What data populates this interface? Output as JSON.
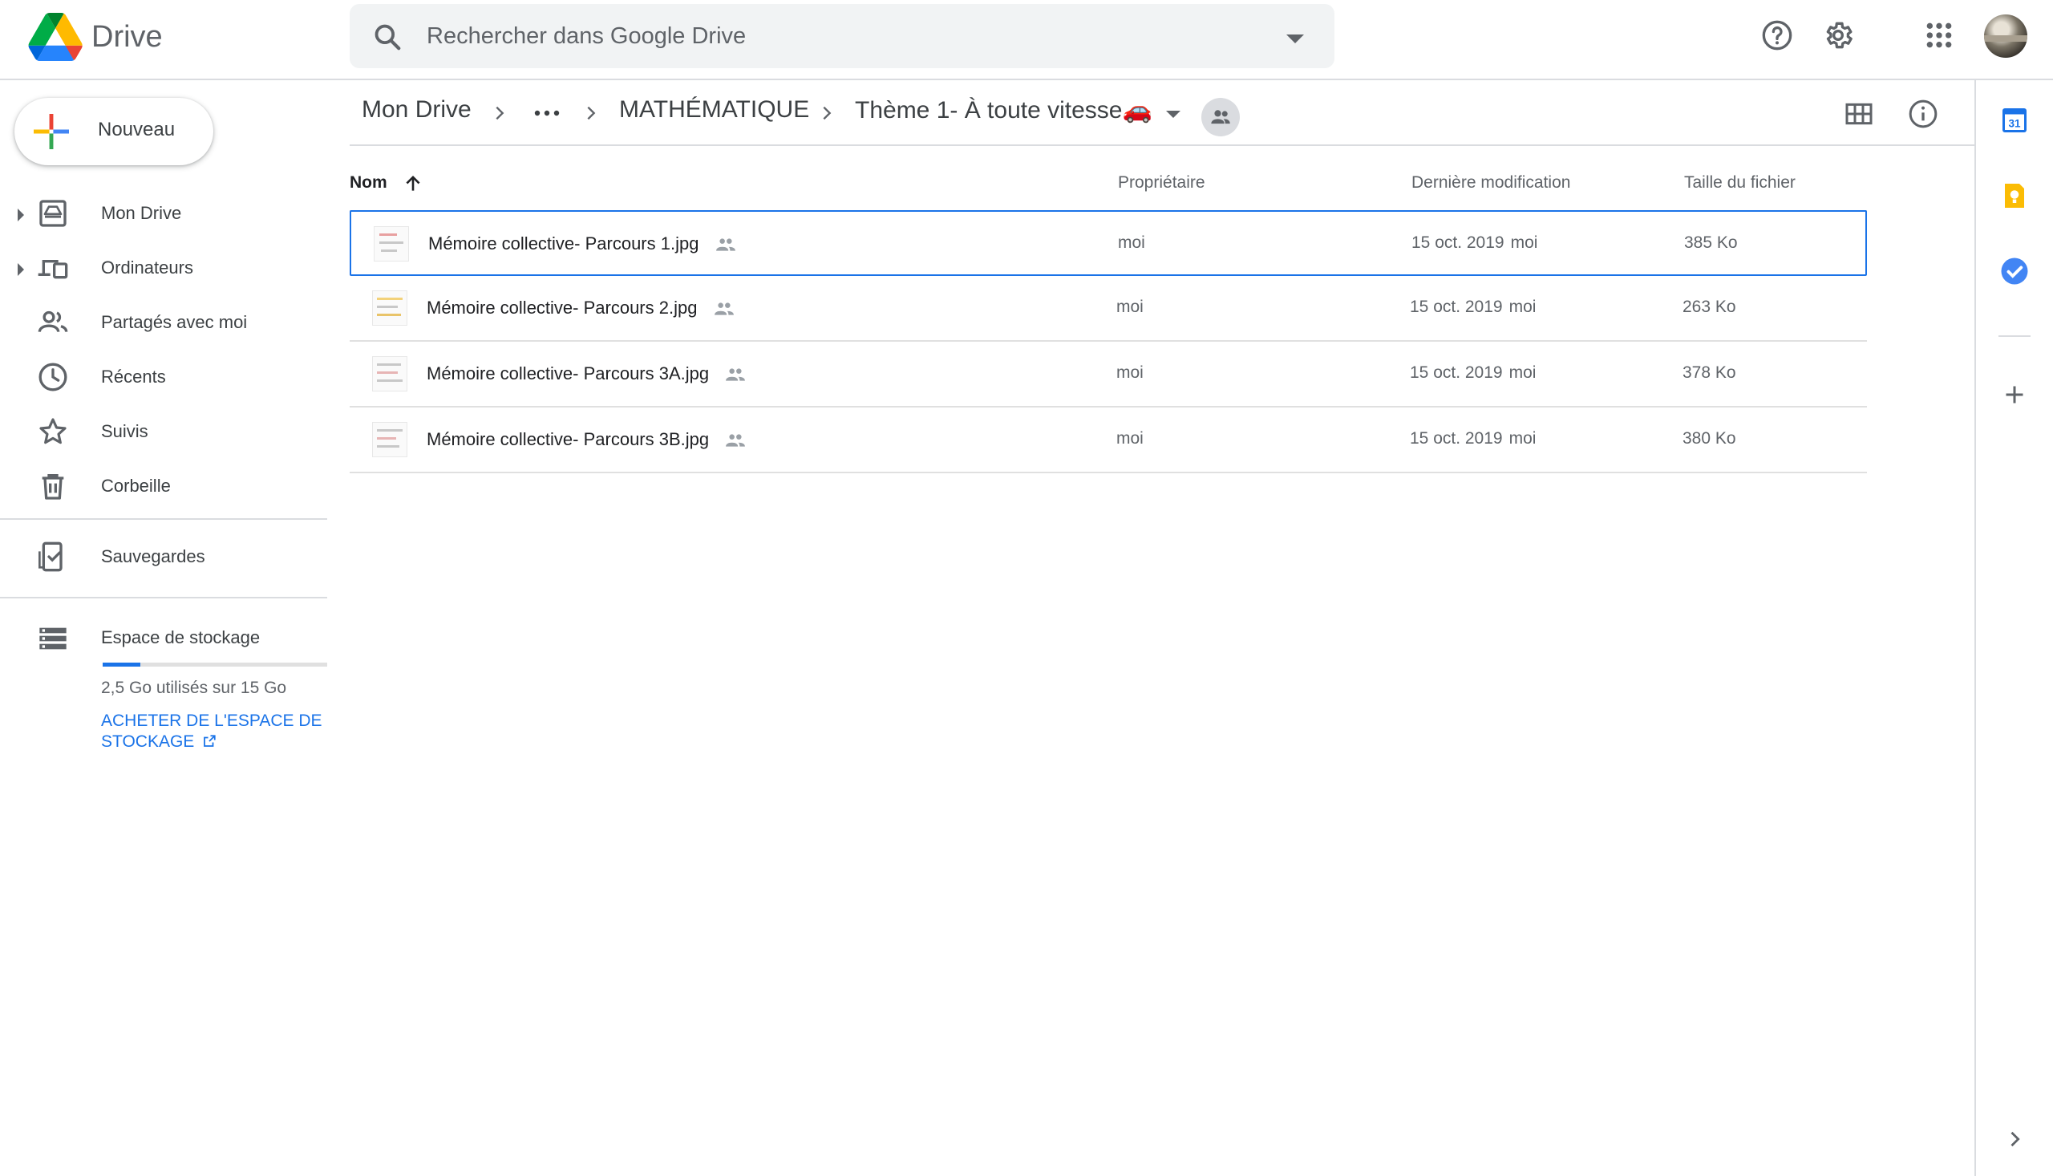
{
  "app": {
    "name": "Drive"
  },
  "search": {
    "placeholder": "Rechercher dans Google Drive"
  },
  "topbar": {
    "icons": [
      "help-icon",
      "settings-icon",
      "apps-grid-icon",
      "account-avatar"
    ]
  },
  "sidebar": {
    "new_label": "Nouveau",
    "items": [
      {
        "label": "Mon Drive",
        "icon": "my-drive-icon",
        "expandable": true
      },
      {
        "label": "Ordinateurs",
        "icon": "computers-icon",
        "expandable": true
      },
      {
        "label": "Partagés avec moi",
        "icon": "shared-with-me-icon",
        "expandable": false
      },
      {
        "label": "Récents",
        "icon": "clock-icon",
        "expandable": false
      },
      {
        "label": "Suivis",
        "icon": "star-icon",
        "expandable": false
      },
      {
        "label": "Corbeille",
        "icon": "trash-icon",
        "expandable": false
      }
    ],
    "backups_label": "Sauvegardes",
    "storage": {
      "label": "Espace de stockage",
      "used_text": "2,5 Go utilisés sur 15 Go",
      "used_fraction": 0.167,
      "buy_label": "ACHETER DE L'ESPACE DE STOCKAGE"
    }
  },
  "breadcrumb": {
    "root": "Mon Drive",
    "more": "•••",
    "parent": "MATHÉMATIQUE",
    "current": "Thème 1- À toute vitesse🚗"
  },
  "list": {
    "headers": {
      "name": "Nom",
      "owner": "Propriétaire",
      "modified": "Dernière modification",
      "size": "Taille du fichier"
    },
    "rows": [
      {
        "name": "Mémoire collective- Parcours 1.jpg",
        "owner": "moi",
        "date": "15 oct. 2019",
        "by": "moi",
        "size": "385 Ko",
        "selected": true
      },
      {
        "name": "Mémoire collective- Parcours 2.jpg",
        "owner": "moi",
        "date": "15 oct. 2019",
        "by": "moi",
        "size": "263 Ko",
        "selected": false
      },
      {
        "name": "Mémoire collective- Parcours 3A.jpg",
        "owner": "moi",
        "date": "15 oct. 2019",
        "by": "moi",
        "size": "378 Ko",
        "selected": false
      },
      {
        "name": "Mémoire collective- Parcours 3B.jpg",
        "owner": "moi",
        "date": "15 oct. 2019",
        "by": "moi",
        "size": "380 Ko",
        "selected": false
      }
    ]
  },
  "sidepanel": {
    "calendar_day": "31",
    "icons": [
      "calendar-icon",
      "keep-icon",
      "tasks-icon",
      "add-addon-icon",
      "expand-panel-icon"
    ]
  },
  "colors": {
    "accent": "#1a73e8",
    "divider": "#dadce0",
    "text_secondary": "#5f6368"
  }
}
